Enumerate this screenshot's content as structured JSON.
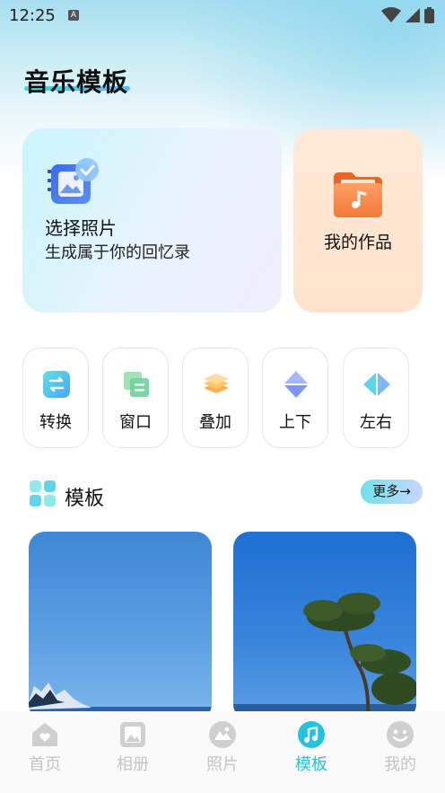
{
  "status_bar": {
    "time": "12:25",
    "notification_badge": "A"
  },
  "page": {
    "title": "音乐模板"
  },
  "feature_cards": {
    "select_photos": {
      "title": "选择照片",
      "subtitle": "生成属于你的回忆录",
      "icon": "photo-album-icon"
    },
    "my_works": {
      "title": "我的作品",
      "icon": "music-folder-icon"
    }
  },
  "effects": [
    {
      "label": "转换",
      "icon": "swap-icon"
    },
    {
      "label": "窗口",
      "icon": "window-icon"
    },
    {
      "label": "叠加",
      "icon": "layers-icon"
    },
    {
      "label": "上下",
      "icon": "up-down-icon"
    },
    {
      "label": "左右",
      "icon": "left-right-icon"
    }
  ],
  "templates_section": {
    "title": "模板",
    "more_label": "更多→"
  },
  "bottom_nav": {
    "items": [
      {
        "label": "首页",
        "icon": "home-icon",
        "active": false
      },
      {
        "label": "相册",
        "icon": "album-icon",
        "active": false
      },
      {
        "label": "照片",
        "icon": "photo-icon",
        "active": false
      },
      {
        "label": "模板",
        "icon": "music-note-icon",
        "active": true
      },
      {
        "label": "我的",
        "icon": "smiley-icon",
        "active": false
      }
    ]
  },
  "colors": {
    "accent": "#23c3e0",
    "inactive": "#c4c4c4"
  }
}
